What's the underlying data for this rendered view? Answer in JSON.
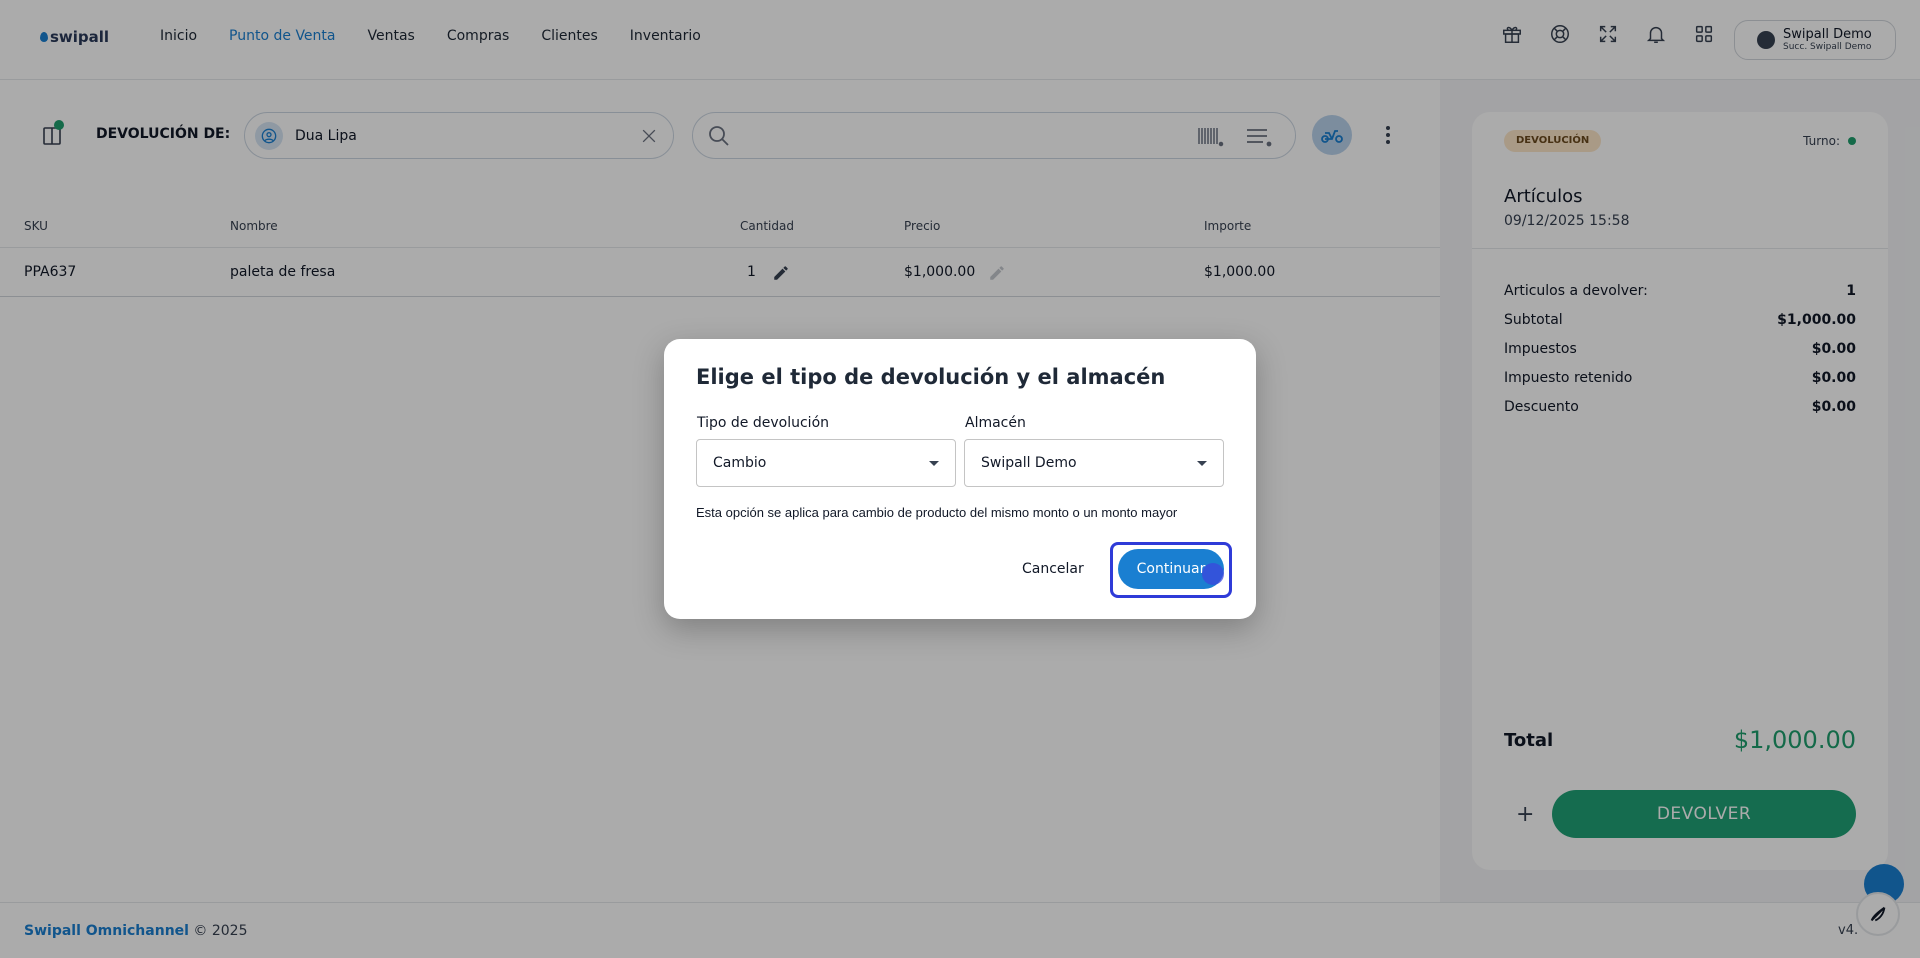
{
  "header": {
    "logo_text": "swipall",
    "nav": [
      "Inicio",
      "Punto de Venta",
      "Ventas",
      "Compras",
      "Clientes",
      "Inventario"
    ],
    "active_nav": "Punto de Venta",
    "icons": [
      "gift-icon",
      "help-lifebuoy-icon",
      "fullscreen-icon",
      "bell-icon",
      "apps-grid-icon"
    ],
    "user": {
      "name": "Swipall Demo",
      "branch": "Succ. Swipall Demo"
    }
  },
  "toolbar": {
    "return_label": "DEVOLUCIÓN DE:",
    "client_name": "Dua Lipa",
    "search_placeholder": ""
  },
  "table": {
    "columns": [
      "SKU",
      "Nombre",
      "Cantidad",
      "Precio",
      "Importe"
    ],
    "rows": [
      {
        "sku": "PPA637",
        "name": "paleta de fresa",
        "qty": "1",
        "price": "$1,000.00",
        "amount": "$1,000.00"
      }
    ]
  },
  "summary": {
    "badge": "DEVOLUCIÓN",
    "turno_label": "Turno:",
    "title": "Artículos",
    "date": "09/12/2025 15:58",
    "rows": [
      {
        "label": "Articulos a devolver:",
        "value": "1"
      },
      {
        "label": "Subtotal",
        "value": "$1,000.00"
      },
      {
        "label": "Impuestos",
        "value": "$0.00"
      },
      {
        "label": "Impuesto retenido",
        "value": "$0.00"
      },
      {
        "label": "Descuento",
        "value": "$0.00"
      }
    ],
    "total_label": "Total",
    "total_value": "$1,000.00",
    "plus_label": "+",
    "return_button": "DEVOLVER"
  },
  "footer": {
    "brand": "Swipall Omnichannel",
    "copyright": "© 2025",
    "version": "v4.",
    "colors": {
      "accent": "#1a7fd1",
      "success": "#20a176"
    }
  },
  "modal": {
    "title": "Elige el tipo de devolución y el almacén",
    "type_label": "Tipo de devolución",
    "type_value": "Cambio",
    "warehouse_label": "Almacén",
    "warehouse_value": "Swipall Demo",
    "helper": "Esta opción se aplica para cambio de producto del mismo monto o un monto mayor",
    "cancel": "Cancelar",
    "continue": "Continuar"
  }
}
